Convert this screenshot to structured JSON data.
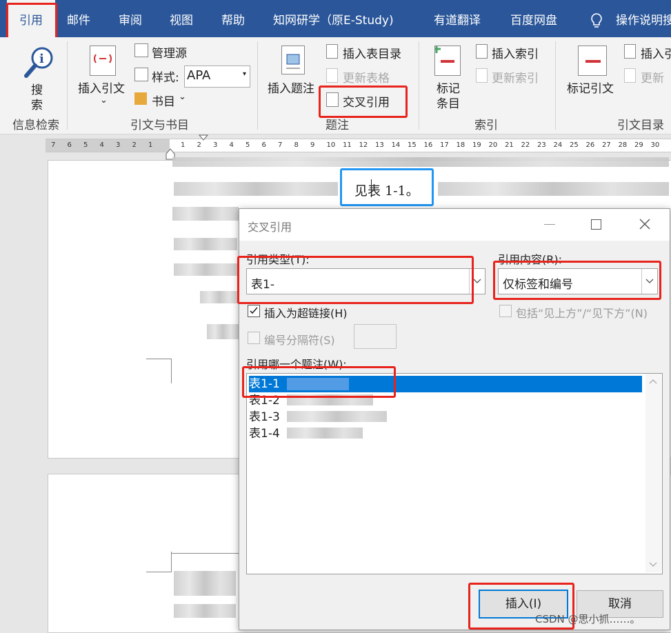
{
  "tabs": [
    "引用",
    "邮件",
    "审阅",
    "视图",
    "帮助",
    "知网研学（原E-Study)",
    "有道翻译",
    "百度网盘",
    "操作说明搜"
  ],
  "ribbon": {
    "search_label_1": "搜",
    "search_label_2": "索",
    "group_info_search": "信息检索",
    "insert_citation": "插入引文",
    "manage_sources": "管理源",
    "style_label": "样式:",
    "style_value": "APA",
    "bibliography": "书目",
    "group_citations": "引文与书目",
    "insert_caption": "插入题注",
    "insert_toc_table": "插入表目录",
    "update_table": "更新表格",
    "cross_reference": "交叉引用",
    "group_captions": "题注",
    "mark_entry_1": "标记",
    "mark_entry_2": "条目",
    "insert_index": "插入索引",
    "update_index": "更新索引",
    "group_index": "索引",
    "mark_citation": "标记引文",
    "insert_toa": "插入引",
    "update_toa": "更新",
    "group_toa": "引文目录"
  },
  "ruler": {
    "numbers": [
      "7",
      "6",
      "5",
      "4",
      "3",
      "2",
      "1",
      "",
      "1",
      "2",
      "3",
      "4",
      "5",
      "6",
      "7",
      "8",
      "9",
      "10",
      "11",
      "12",
      "13",
      "14",
      "15",
      "16",
      "17",
      "18",
      "19",
      "20",
      "21",
      "22",
      "23",
      "24",
      "25",
      "26",
      "27",
      "28",
      "29",
      "30"
    ]
  },
  "doc": {
    "highlight_text": "见表  1-1。"
  },
  "dialog": {
    "title": "交叉引用",
    "ref_type_label": "引用类型(T):",
    "ref_type_value": "表1-",
    "ref_content_label": "引用内容(R):",
    "ref_content_value": "仅标签和编号",
    "hyperlink_label": "插入为超链接(H)",
    "hyperlink_checked": true,
    "above_below_label": "包括“见上方”/“见下方”(N)",
    "separator_label": "编号分隔符(S)",
    "which_caption_label": "引用哪一个题注(W):",
    "captions": [
      "表1-1",
      "表1-2",
      "表1-3",
      "表1-4"
    ],
    "insert_button": "插入(I)",
    "cancel_button": "取消"
  },
  "watermark": "CSDN @思小抓……。"
}
